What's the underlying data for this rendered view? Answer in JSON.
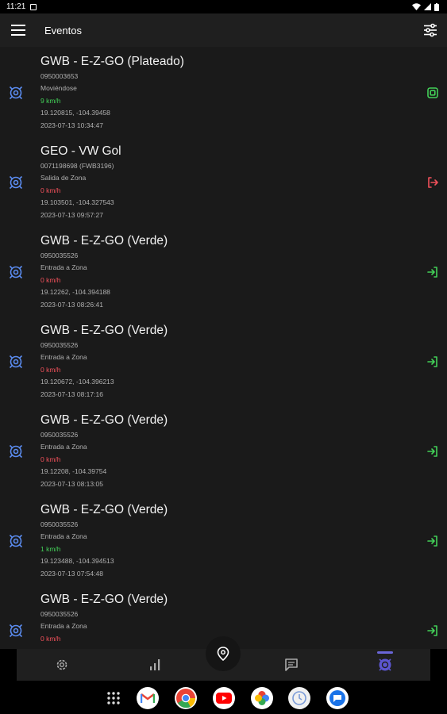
{
  "status_bar": {
    "time": "11:21"
  },
  "app_bar": {
    "title": "Eventos"
  },
  "events": [
    {
      "name": "GWB - E-Z-GO (Plateado)",
      "id": "0950003653",
      "type": "Moviéndose",
      "speed": "9 km/h",
      "speed_status": "moving",
      "coords": "19.120815, -104.39458",
      "datetime": "2023-07-13 10:34:47",
      "trailing_icon": "moving-event-icon"
    },
    {
      "name": "GEO - VW Gol",
      "id": "0071198698 (FWB3196)",
      "type": "Salida de Zona",
      "speed": "0 km/h",
      "speed_status": "stopped",
      "coords": "19.103501, -104.327543",
      "datetime": "2023-07-13 09:57:27",
      "trailing_icon": "zone-exit-icon"
    },
    {
      "name": "GWB - E-Z-GO (Verde)",
      "id": "0950035526",
      "type": "Entrada a Zona",
      "speed": "0 km/h",
      "speed_status": "stopped",
      "coords": "19.12262, -104.394188",
      "datetime": "2023-07-13 08:26:41",
      "trailing_icon": "zone-entry-icon"
    },
    {
      "name": "GWB - E-Z-GO (Verde)",
      "id": "0950035526",
      "type": "Entrada a Zona",
      "speed": "0 km/h",
      "speed_status": "stopped",
      "coords": "19.120672, -104.396213",
      "datetime": "2023-07-13 08:17:16",
      "trailing_icon": "zone-entry-icon"
    },
    {
      "name": "GWB - E-Z-GO (Verde)",
      "id": "0950035526",
      "type": "Entrada a Zona",
      "speed": "0 km/h",
      "speed_status": "stopped",
      "coords": "19.12208, -104.39754",
      "datetime": "2023-07-13 08:13:05",
      "trailing_icon": "zone-entry-icon"
    },
    {
      "name": "GWB - E-Z-GO (Verde)",
      "id": "0950035526",
      "type": "Entrada a Zona",
      "speed": "1 km/h",
      "speed_status": "moving",
      "coords": "19.123488, -104.394513",
      "datetime": "2023-07-13 07:54:48",
      "trailing_icon": "zone-entry-icon"
    },
    {
      "name": "GWB - E-Z-GO (Verde)",
      "id": "0950035526",
      "type": "Entrada a Zona",
      "speed": "0 km/h",
      "speed_status": "stopped",
      "coords": "",
      "datetime": "",
      "trailing_icon": "zone-entry-icon"
    }
  ],
  "bottom_nav": {
    "items": [
      "settings",
      "stats",
      "map",
      "messages",
      "events"
    ],
    "active": "events"
  },
  "taskbar": {
    "apps": [
      "app-drawer",
      "gmail",
      "chrome",
      "youtube",
      "photos",
      "clock",
      "messages"
    ]
  },
  "colors": {
    "background": "#1a1a1a",
    "app_bar": "#1f1f1f",
    "moving": "#43d058",
    "stopped": "#f0505a",
    "accent": "#5b8cf0",
    "active_nav": "#6a66d8"
  }
}
